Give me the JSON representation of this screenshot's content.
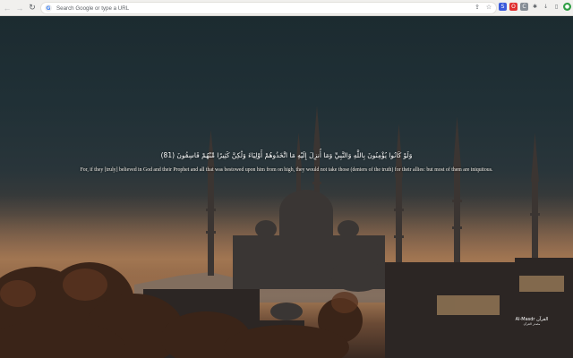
{
  "browser": {
    "omnibox_placeholder": "Search Google or type a URL",
    "omnibox_icon_glyph": "G",
    "extensions": [
      {
        "name": "extension-1-icon",
        "glyph": "S",
        "color": "#3b5bdb"
      },
      {
        "name": "extension-2-icon",
        "glyph": "O",
        "color": "#e03131"
      },
      {
        "name": "extension-3-icon",
        "glyph": "C",
        "color": "#6c757d"
      },
      {
        "name": "puzzle-icon",
        "glyph": "✱",
        "color": "#5f6368"
      },
      {
        "name": "download-icon",
        "glyph": "↓",
        "color": "#5f6368"
      },
      {
        "name": "sidepanel-icon",
        "glyph": "▯",
        "color": "#5f6368"
      },
      {
        "name": "profile-icon",
        "glyph": "●",
        "color": "#2f9e44"
      },
      {
        "name": "menu-icon",
        "glyph": "⋮",
        "color": "#5f6368"
      }
    ]
  },
  "verse": {
    "arabic": "وَلَوْ كَانُوا يُؤْمِنُونَ بِاللَّهِ وَالنَّبِيِّ وَمَا أُنزِلَ إِلَيْهِ مَا اتَّخَذُوهُمْ أَوْلِيَاءَ وَلَٰكِنَّ كَثِيرًا مِّنْهُمْ فَاسِقُونَ (81)",
    "translation": "For, if they [truly] believed in God and their Prophet and all that was bestowed upon him from on high, they would not take those (deniers of the truth) for their allies: but most of them are iniquitous."
  },
  "watermark": {
    "line1": "Al-Masdr القرآن",
    "line2": "مصدر القرآن"
  }
}
